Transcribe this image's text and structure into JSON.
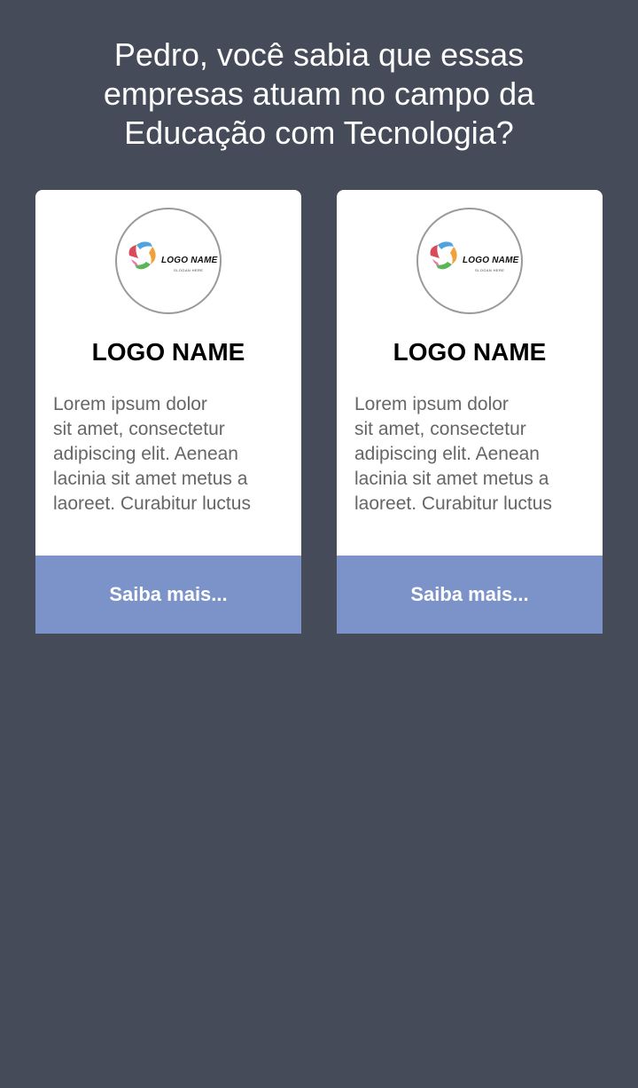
{
  "headline": "Pedro, você sabia que essas empresas atuam no campo da Educação com Tecnologia?",
  "colors": {
    "background": "#464b5a",
    "card": "#ffffff",
    "button": "#7b93c9",
    "logo_petal_red": "#d94a5a",
    "logo_petal_blue": "#4fa3de",
    "logo_petal_orange": "#f0a23a",
    "logo_petal_green": "#5db55a"
  },
  "cards": [
    {
      "logo": {
        "icon": "logo-mark-icon",
        "wordmark": "LOGO NAME",
        "slogan": "SLOGAN HERE"
      },
      "name": "LOGO NAME",
      "description": [
        "Lorem ipsum dolor",
        "sit amet, consectetur",
        "adipiscing elit. Aenean",
        "lacinia sit amet metus a",
        "laoreet. Curabitur luctus"
      ],
      "button_label": "Saiba mais..."
    },
    {
      "logo": {
        "icon": "logo-mark-icon",
        "wordmark": "LOGO NAME",
        "slogan": "SLOGAN HERE"
      },
      "name": "LOGO NAME",
      "description": [
        "Lorem ipsum dolor",
        "sit amet, consectetur",
        "adipiscing elit. Aenean",
        "lacinia sit amet metus a",
        "laoreet. Curabitur luctus"
      ],
      "button_label": "Saiba mais..."
    }
  ]
}
